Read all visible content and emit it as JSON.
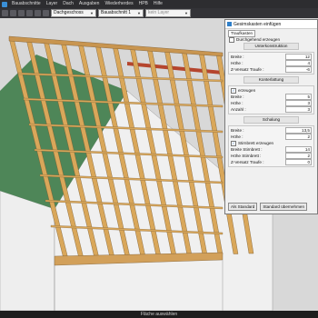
{
  "menu": {
    "items": [
      "Bauabschnitte",
      "Layer",
      "Dach",
      "Ausgaben",
      "Wiederherdes",
      "HPB",
      "Hilfe"
    ]
  },
  "toolbar": {
    "floor": "Dachgeschoss",
    "section": "Bauabschnitt 1",
    "layer_placeholder": "kein Layer"
  },
  "dialog": {
    "title": "Gesimskasten einfügen",
    "tab": "Traufkasten",
    "through_label": "Durchgehend erzeugen",
    "unterkonstruktion": {
      "header": "Unterkonstruktion",
      "rows": [
        {
          "label": "Breite :",
          "value": "12"
        },
        {
          "label": "Höhe :",
          "value": "4"
        },
        {
          "label": "Z-Versatz Traufe :",
          "value": "-6"
        }
      ]
    },
    "konterlattung": {
      "header": "Konterlattung",
      "create_label": "erzeugen",
      "rows": [
        {
          "label": "Breite :",
          "value": "5"
        },
        {
          "label": "Höhe :",
          "value": "3"
        },
        {
          "label": "Anzahl :",
          "value": "3"
        }
      ]
    },
    "schalung": {
      "header": "Schalung",
      "rows": [
        {
          "label": "Breite :",
          "value": "13,5"
        },
        {
          "label": "Höhe :",
          "value": "2"
        }
      ],
      "stirnbrett_label": "Stirnbrett erzeugen",
      "rows2": [
        {
          "label": "Breite Stirnbrett :",
          "value": "14"
        },
        {
          "label": "Höhe Stirnbrett :",
          "value": "2"
        },
        {
          "label": "Z-Versatz Traufe :",
          "value": "0"
        }
      ]
    },
    "btn_standard": "Als Standard",
    "btn_apply": "Standard übernehmen"
  },
  "status": {
    "text": "Fläche auswählen"
  },
  "colors": {
    "rafter": "#d9a75a",
    "roof_green": "#3f7d4a",
    "wall": "#efefef"
  }
}
